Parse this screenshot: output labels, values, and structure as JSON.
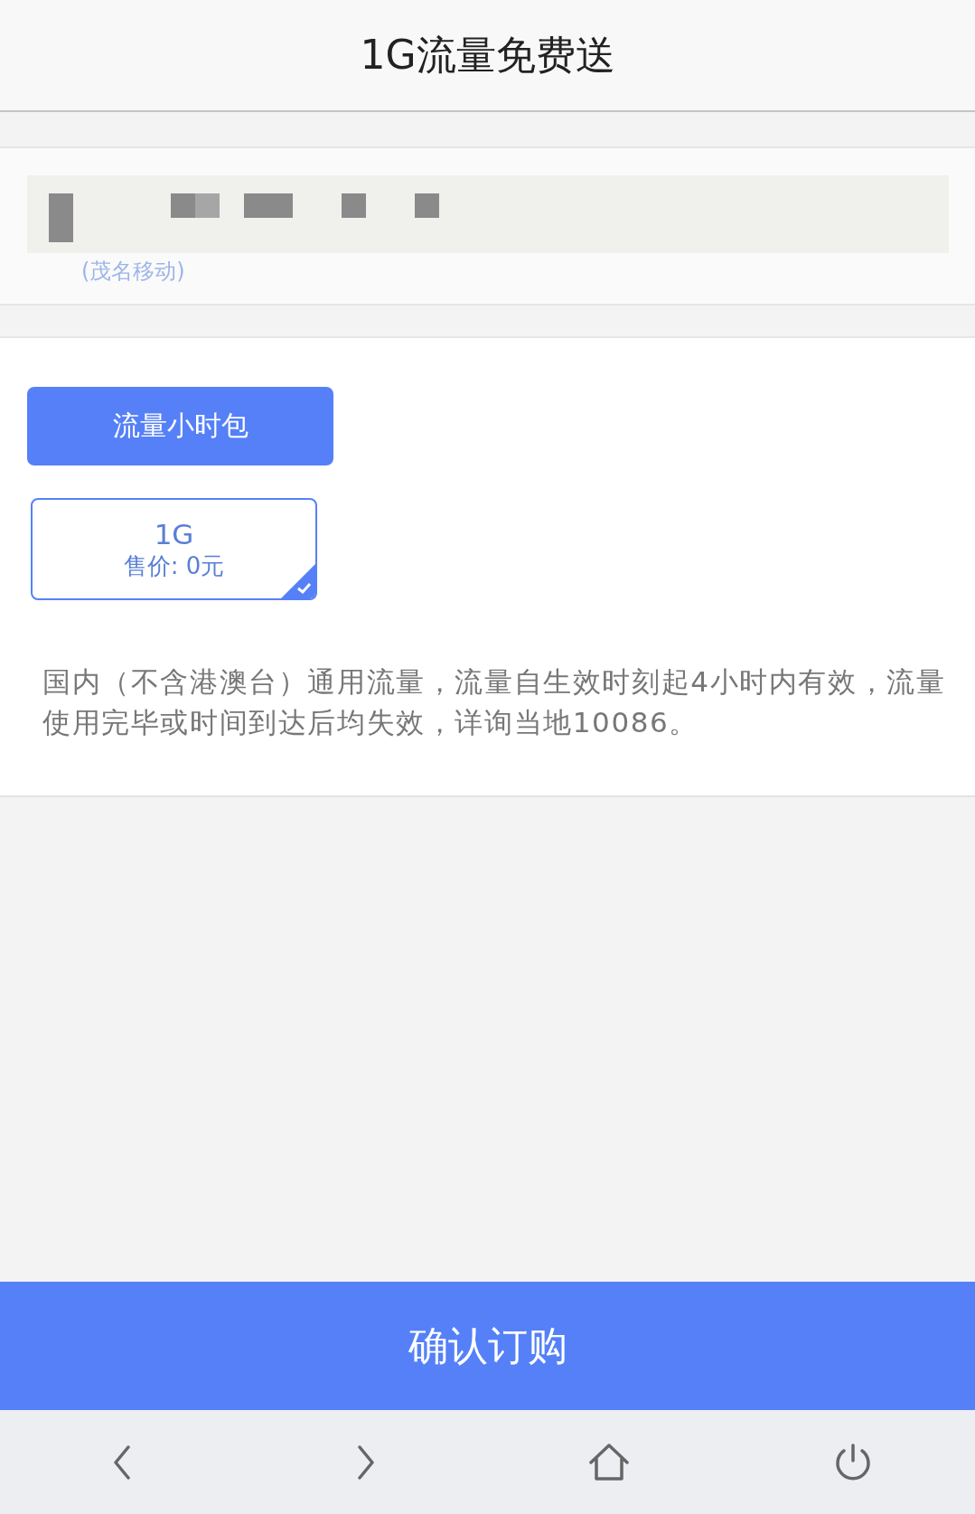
{
  "header": {
    "title": "1G流量免费送"
  },
  "account": {
    "operator": "(茂名移动)"
  },
  "categories": [
    {
      "label": "流量小时包",
      "selected": true
    }
  ],
  "plans": [
    {
      "size": "1G",
      "price": "售价: 0元",
      "selected": true
    }
  ],
  "description": "国内（不含港澳台）通用流量，流量自生效时刻起4小时内有效，流量使用完毕或时间到达后均失效，详询当地10086。",
  "confirm_button": "确认订购",
  "nav_bar": [
    {
      "kind": "back"
    },
    {
      "kind": "forward"
    },
    {
      "kind": "home"
    },
    {
      "kind": "power"
    }
  ]
}
